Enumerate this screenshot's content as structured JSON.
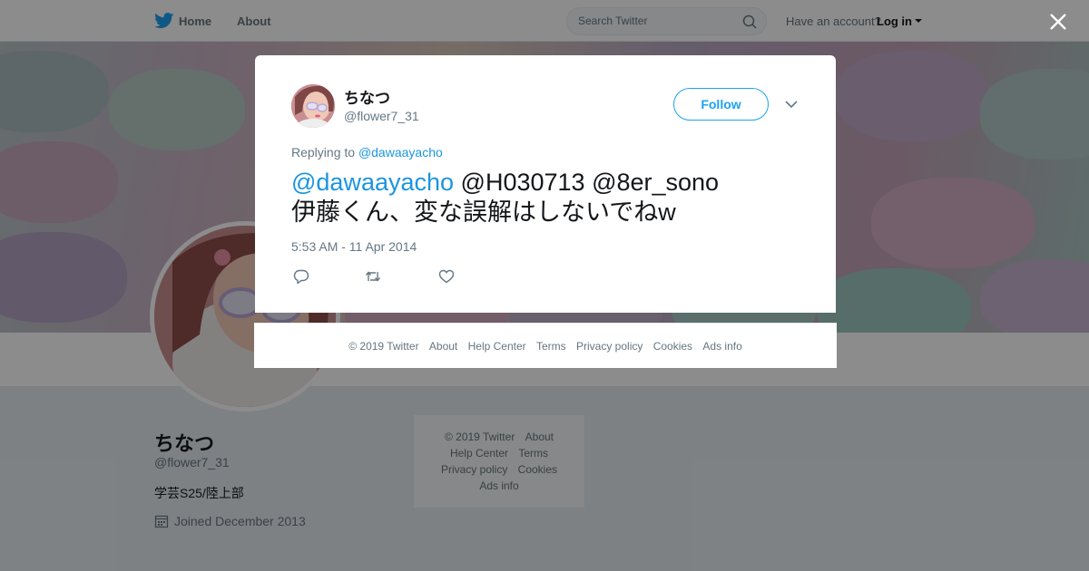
{
  "topbar": {
    "logo_icon": "twitter-bird-icon",
    "home_label": "Home",
    "about_label": "About",
    "search_placeholder": "Search Twitter",
    "account_prompt": "Have an account?",
    "login_label": "Log in"
  },
  "profile": {
    "name": "ちなつ",
    "handle": "@flower7_31",
    "bio": "学芸S25/陸上部",
    "joined": "Joined December 2013"
  },
  "side_footer": {
    "copyright": "© 2019 Twitter",
    "about": "About",
    "help": "Help Center",
    "terms": "Terms",
    "privacy": "Privacy policy",
    "cookies": "Cookies",
    "ads": "Ads info"
  },
  "tweet": {
    "name": "ちなつ",
    "handle": "@flower7_31",
    "follow_label": "Follow",
    "replying_prefix": "Replying to",
    "replying_to": "@dawaayacho",
    "mention_1": "@dawaayacho",
    "mention_2": "@H030713",
    "mention_3": "@8er_sono",
    "body": "伊藤くん、変な誤解はしないでねw",
    "timestamp": "5:53 AM - 11 Apr 2014"
  },
  "modal_footer": {
    "copyright": "© 2019 Twitter",
    "about": "About",
    "help": "Help Center",
    "terms": "Terms",
    "privacy": "Privacy policy",
    "cookies": "Cookies",
    "ads": "Ads info"
  },
  "colors": {
    "brand_blue": "#1da1f2",
    "link_blue": "#1b95e0",
    "overlay": "rgba(0,0,0,0.45)"
  }
}
